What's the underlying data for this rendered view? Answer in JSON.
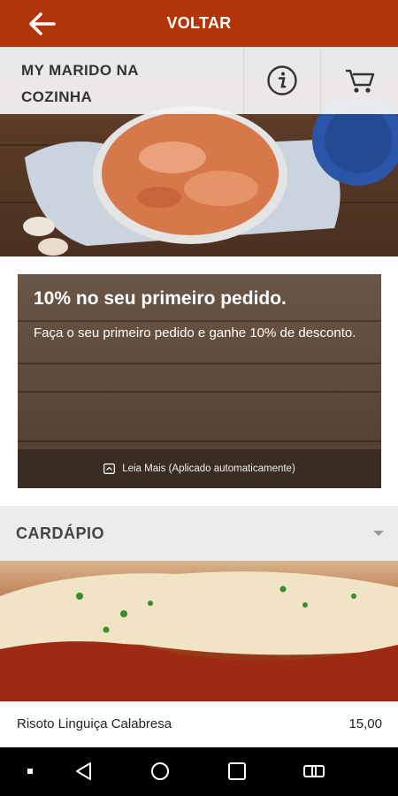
{
  "topbar": {
    "back_icon": "arrow-left-icon",
    "title": "VOLTAR",
    "color": "#b2350a"
  },
  "restaurant": {
    "name_line1": "MY MARIDO NA",
    "name_line2": "COZINHA",
    "info_icon": "info-icon",
    "cart_icon": "cart-icon"
  },
  "promo": {
    "title": "10% no seu primeiro pedido.",
    "description": "Faça o seu primeiro pedido e ganhe 10% de desconto.",
    "footer_icon": "expand-icon",
    "footer_text": "Leia Mais (Aplicado automaticamente)"
  },
  "menu": {
    "section_title": "CARDÁPIO",
    "items": [
      {
        "name": "Risoto Linguiça Calabresa",
        "price": "15,00"
      }
    ]
  },
  "android_nav": {
    "icons": [
      "dot-icon",
      "back-triangle-icon",
      "home-circle-icon",
      "recents-square-icon",
      "rotate-icon"
    ]
  }
}
